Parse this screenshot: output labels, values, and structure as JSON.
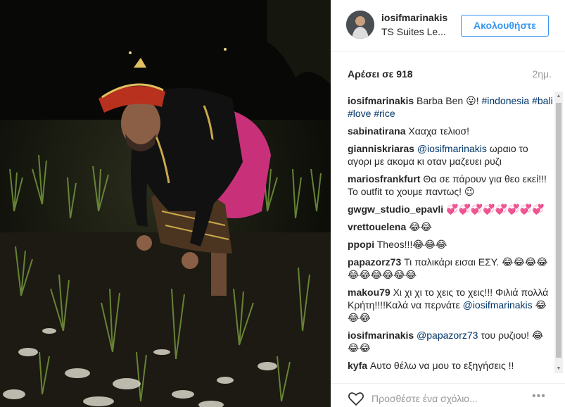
{
  "post": {
    "username": "iosifmarinakis",
    "location": "TS Suites Le...",
    "follow_label": "Ακολουθήστε",
    "likes": "Αρέσει σε 918",
    "time": "2ημ.",
    "photo_alt": "Man in Balinese costume planting rice at night"
  },
  "caption": {
    "user": "iosifmarinakis",
    "text": "Barba Ben 😛! ",
    "tags": [
      "#indonesia",
      "#bali",
      "#love",
      "#rice"
    ]
  },
  "comments": [
    {
      "user": "sabinatirana",
      "text": "Χααχα τελιοσ!"
    },
    {
      "user": "gianniskriaras",
      "mention": "@iosifmarinakis",
      "text": " ωραιο το αγορι με ακομα κι οταν μαζευει ρυζι"
    },
    {
      "user": "mariosfrankfurt",
      "text": "Θα σε πάρουν για θεο εκεί!!! Το outfit το χουμε παντως! 😉"
    },
    {
      "user": "gwgw_studio_epavli",
      "text": "💞💞💞💞💞💞💞💞"
    },
    {
      "user": "vrettouelena",
      "text": "😂😂"
    },
    {
      "user": "ppopi",
      "text": "Theos!!!😂😂😂"
    },
    {
      "user": "papazorz73",
      "text": "Τι παλικάρι εισαι ΕΣΥ. 😂😂😂😂😂😂😂😂😂😂"
    },
    {
      "user": "makou79",
      "text": "Χι χι χι το χεις το χεις!!! Φιλιά πολλά Κρήτη!!!!Καλά να περνάτε ",
      "mention_after": "@iosifmarinakis",
      "text_after": " 😂😂😂"
    },
    {
      "user": "iosifmarinakis",
      "mention": "@papazorz73",
      "text": " του ρυζιου! 😂😂😂"
    },
    {
      "user": "kyfa",
      "text": "Αυτο θέλω να μου το εξηγήσεις !!"
    }
  ],
  "footer": {
    "placeholder": "Προσθέστε ένα σχόλιο...",
    "more_label": "•••"
  }
}
